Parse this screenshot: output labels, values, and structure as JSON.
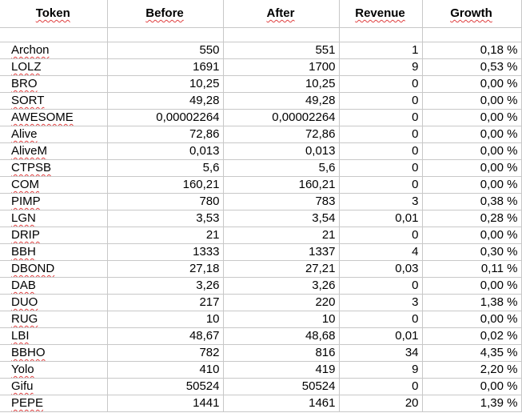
{
  "headers": {
    "token": "Token",
    "before": "Before",
    "after": "After",
    "revenue": "Revenue",
    "growth": "Growth"
  },
  "rows": [
    {
      "token": "Archon",
      "before": "550",
      "after": "551",
      "revenue": "1",
      "growth": "0,18 %"
    },
    {
      "token": "LOLZ",
      "before": "1691",
      "after": "1700",
      "revenue": "9",
      "growth": "0,53 %"
    },
    {
      "token": "BRO",
      "before": "10,25",
      "after": "10,25",
      "revenue": "0",
      "growth": "0,00 %"
    },
    {
      "token": "SORT",
      "before": "49,28",
      "after": "49,28",
      "revenue": "0",
      "growth": "0,00 %"
    },
    {
      "token": "AWESOME",
      "before": "0,00002264",
      "after": "0,00002264",
      "revenue": "0",
      "growth": "0,00 %"
    },
    {
      "token": "Alive",
      "before": "72,86",
      "after": "72,86",
      "revenue": "0",
      "growth": "0,00 %"
    },
    {
      "token": "AliveM",
      "before": "0,013",
      "after": "0,013",
      "revenue": "0",
      "growth": "0,00 %"
    },
    {
      "token": "CTPSB",
      "before": "5,6",
      "after": "5,6",
      "revenue": "0",
      "growth": "0,00 %"
    },
    {
      "token": "COM",
      "before": "160,21",
      "after": "160,21",
      "revenue": "0",
      "growth": "0,00 %"
    },
    {
      "token": "PIMP",
      "before": "780",
      "after": "783",
      "revenue": "3",
      "growth": "0,38 %"
    },
    {
      "token": "LGN",
      "before": "3,53",
      "after": "3,54",
      "revenue": "0,01",
      "growth": "0,28 %"
    },
    {
      "token": "DRIP",
      "before": "21",
      "after": "21",
      "revenue": "0",
      "growth": "0,00 %"
    },
    {
      "token": "BBH",
      "before": "1333",
      "after": "1337",
      "revenue": "4",
      "growth": "0,30 %"
    },
    {
      "token": "DBOND",
      "before": "27,18",
      "after": "27,21",
      "revenue": "0,03",
      "growth": "0,11 %"
    },
    {
      "token": "DAB",
      "before": "3,26",
      "after": "3,26",
      "revenue": "0",
      "growth": "0,00 %"
    },
    {
      "token": "DUO",
      "before": "217",
      "after": "220",
      "revenue": "3",
      "growth": "1,38 %"
    },
    {
      "token": "RUG",
      "before": "10",
      "after": "10",
      "revenue": "0",
      "growth": "0,00 %"
    },
    {
      "token": "LBI",
      "before": "48,67",
      "after": "48,68",
      "revenue": "0,01",
      "growth": "0,02 %"
    },
    {
      "token": "BBHO",
      "before": "782",
      "after": "816",
      "revenue": "34",
      "growth": "4,35 %"
    },
    {
      "token": "Yolo",
      "before": "410",
      "after": "419",
      "revenue": "9",
      "growth": "2,20 %"
    },
    {
      "token": "Gifu",
      "before": "50524",
      "after": "50524",
      "revenue": "0",
      "growth": "0,00 %"
    },
    {
      "token": "PEPE",
      "before": "1441",
      "after": "1461",
      "revenue": "20",
      "growth": "1,39 %"
    }
  ],
  "colors": {
    "gridline": "#c8c8c8",
    "spellcheck_underline": "#e04040"
  }
}
